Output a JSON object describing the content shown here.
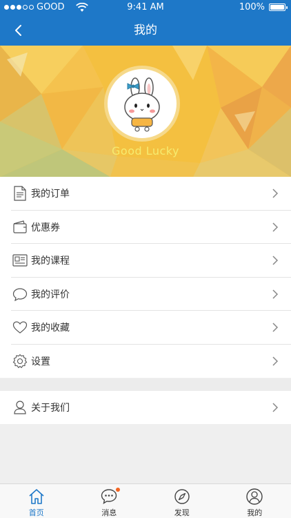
{
  "status_bar": {
    "carrier": "GOOD",
    "time": "9:41 AM",
    "battery": "100%"
  },
  "nav": {
    "title": "我的"
  },
  "profile": {
    "username": "Good Lucky"
  },
  "menu": [
    {
      "label": "我的订单",
      "icon": "document-icon"
    },
    {
      "label": "优惠券",
      "icon": "wallet-icon"
    },
    {
      "label": "我的课程",
      "icon": "newspaper-icon"
    },
    {
      "label": "我的评价",
      "icon": "chat-bubble-icon"
    },
    {
      "label": "我的收藏",
      "icon": "heart-icon"
    },
    {
      "label": "设置",
      "icon": "gear-icon"
    }
  ],
  "menu2": [
    {
      "label": "关于我们",
      "icon": "person-icon"
    }
  ],
  "tabs": [
    {
      "label": "首页",
      "icon": "home-icon",
      "active": true
    },
    {
      "label": "消息",
      "icon": "message-icon",
      "badge": true
    },
    {
      "label": "发现",
      "icon": "compass-icon"
    },
    {
      "label": "我的",
      "icon": "profile-icon"
    }
  ],
  "colors": {
    "primary": "#1e78c8",
    "banner": "#f4c040",
    "badge": "#f26522"
  }
}
